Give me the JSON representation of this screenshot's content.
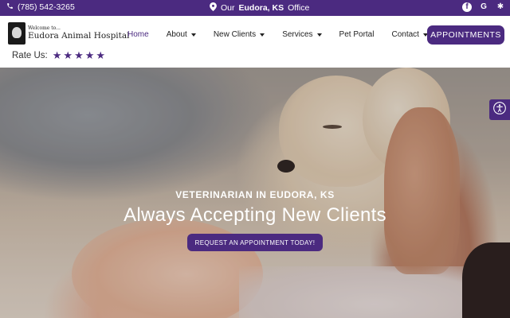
{
  "topbar": {
    "phone": "(785) 542-3265",
    "office_prefix": "Our",
    "office_city": "Eudora, KS",
    "office_suffix": "Office",
    "social": [
      {
        "icon": "facebook-icon",
        "glyph": "f"
      },
      {
        "icon": "google-icon",
        "glyph": "G"
      },
      {
        "icon": "yelp-icon",
        "glyph": "✱"
      }
    ]
  },
  "logo": {
    "small": "Welcome to...",
    "big": "Eudora Animal Hospital"
  },
  "rating": {
    "label": "Rate Us:",
    "stars": 5
  },
  "nav": {
    "items": [
      {
        "label": "Home",
        "active": true,
        "dropdown": false
      },
      {
        "label": "About",
        "active": false,
        "dropdown": true
      },
      {
        "label": "New Clients",
        "active": false,
        "dropdown": true
      },
      {
        "label": "Services",
        "active": false,
        "dropdown": true
      },
      {
        "label": "Pet Portal",
        "active": false,
        "dropdown": false
      },
      {
        "label": "Contact",
        "active": false,
        "dropdown": true
      }
    ],
    "appointments_label": "APPOINTMENTS"
  },
  "hero": {
    "subtitle": "VETERINARIAN IN EUDORA, KS",
    "title": "Always Accepting New Clients",
    "button_label": "REQUEST AN APPOINTMENT TODAY!"
  },
  "colors": {
    "brand": "#4b2a80"
  }
}
